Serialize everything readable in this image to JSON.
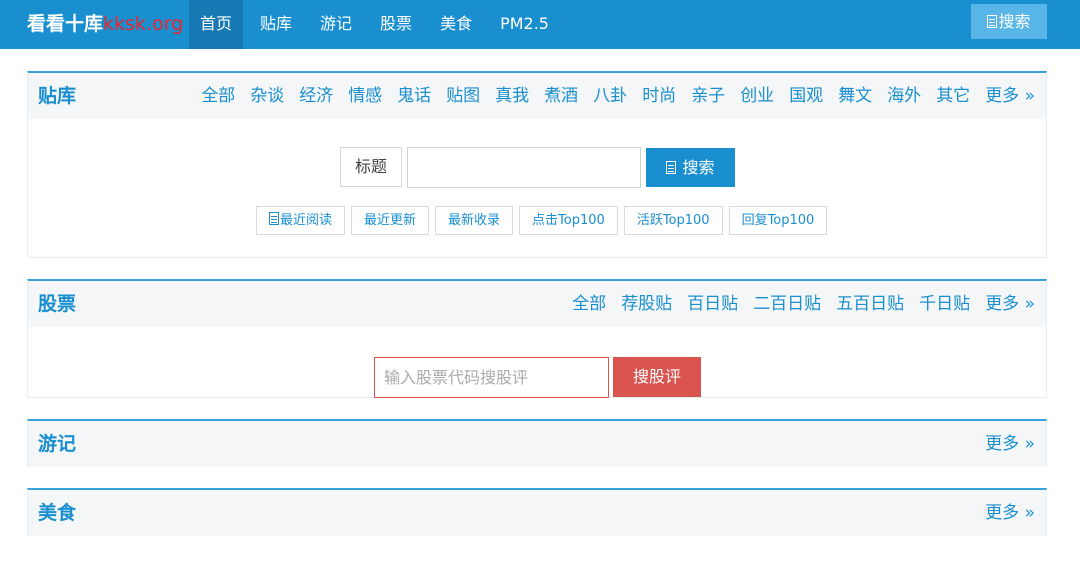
{
  "colors": {
    "brand": "#1a8fd0",
    "nav_active": "#1679b6",
    "stock_red": "#d9534f",
    "domain_red": "#e8262c"
  },
  "header": {
    "logo_cn": "看看十库",
    "logo_domain": "kksk.org",
    "nav": [
      "首页",
      "贴库",
      "游记",
      "股票",
      "美食",
      "PM2.5"
    ],
    "active_nav": "首页",
    "search_label": "搜索",
    "search_icon": "document-icon"
  },
  "tieku": {
    "title": "贴库",
    "categories": [
      "全部",
      "杂谈",
      "经济",
      "情感",
      "鬼话",
      "贴图",
      "真我",
      "煮酒",
      "八卦",
      "时尚",
      "亲子",
      "创业",
      "国观",
      "舞文",
      "海外",
      "其它"
    ],
    "more": "更多 »",
    "search_field_label": "标题",
    "search_value": "",
    "search_button": "搜索",
    "quick_links": [
      "最近阅读",
      "最近更新",
      "最新收录",
      "点击Top100",
      "活跃Top100",
      "回复Top100"
    ]
  },
  "stock": {
    "title": "股票",
    "categories": [
      "全部",
      "荐股贴",
      "百日贴",
      "二百日贴",
      "五百日贴",
      "千日贴"
    ],
    "more": "更多 »",
    "input_placeholder": "输入股票代码搜股评",
    "input_value": "",
    "button": "搜股评"
  },
  "travel": {
    "title": "游记",
    "more": "更多 »"
  },
  "food": {
    "title": "美食",
    "more": "更多 »"
  }
}
